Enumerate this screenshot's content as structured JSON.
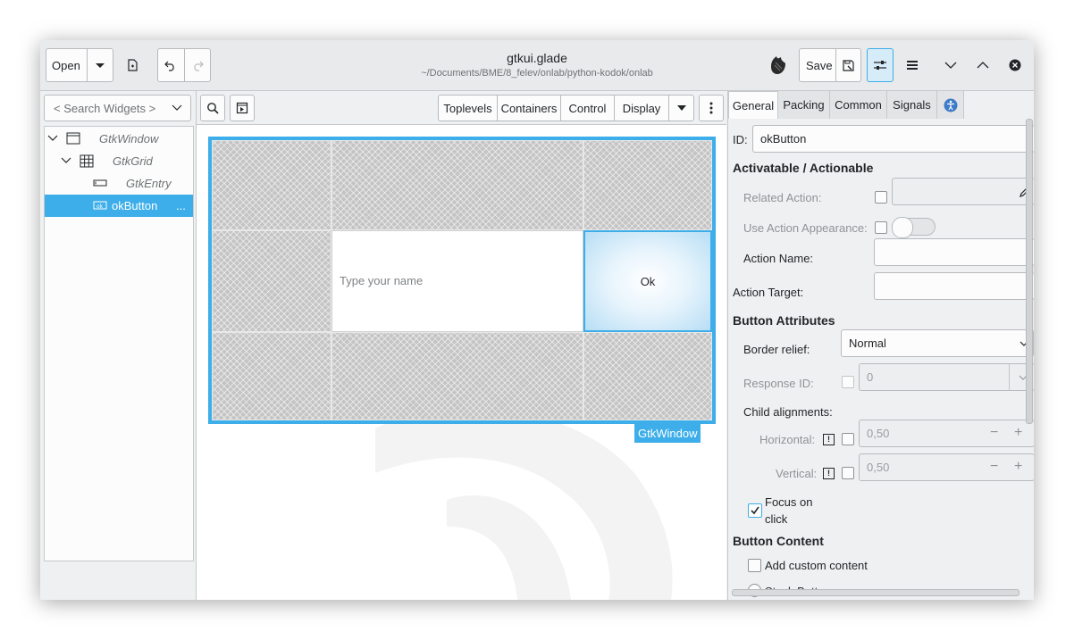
{
  "header": {
    "open_label": "Open",
    "title": "gtkui.glade",
    "path": "~/Documents/BME/8_felev/onlab/python-kodok/onlab",
    "save_label": "Save"
  },
  "search": {
    "placeholder": "< Search Widgets >"
  },
  "tree": {
    "items": [
      {
        "label": "GtkWindow"
      },
      {
        "label": "GtkGrid"
      },
      {
        "label": "GtkEntry"
      },
      {
        "label": "okButton",
        "suffix": "..."
      }
    ]
  },
  "palette": {
    "groups": [
      "Toplevels",
      "Containers",
      "Control",
      "Display"
    ]
  },
  "design": {
    "entry_placeholder": "Type your name",
    "button_label": "Ok",
    "window_label": "GtkWindow"
  },
  "inspector": {
    "tabs": [
      "General",
      "Packing",
      "Common",
      "Signals"
    ],
    "id_label": "ID:",
    "id_value": "okButton",
    "sections": {
      "actionable": "Activatable / Actionable",
      "button_attributes": "Button Attributes",
      "button_content": "Button Content"
    },
    "labels": {
      "related_action": "Related Action:",
      "use_action_appearance": "Use Action Appearance:",
      "action_name": "Action Name:",
      "action_target": "Action Target:",
      "border_relief": "Border relief:",
      "response_id": "Response ID:",
      "child_alignments": "Child alignments:",
      "horizontal": "Horizontal:",
      "vertical": "Vertical:",
      "focus_on_click_1": "Focus on",
      "focus_on_click_2": "click",
      "add_custom_content": "Add custom content",
      "stock_button": "Stock Button"
    },
    "values": {
      "border_relief": "Normal",
      "response_id": "0",
      "horizontal": "0,50",
      "vertical": "0,50",
      "minus": "−",
      "plus": "+",
      "warn": "!"
    }
  },
  "colors": {
    "accent": "#3daee9",
    "window_bg": "#eff0f1",
    "text": "#232629"
  },
  "icons": [
    "chevron-down-icon",
    "new-file-icon",
    "undo-icon",
    "redo-icon",
    "glade-logo-icon",
    "save-as-icon",
    "properties-icon",
    "menu-icon",
    "minimize-icon",
    "maximize-icon",
    "close-icon",
    "search-icon",
    "preview-icon",
    "more-icon",
    "accessibility-icon",
    "pointer-icon",
    "drag-resize-icon",
    "margin-edit-icon",
    "alignment-icon",
    "edit-pencil-icon"
  ]
}
